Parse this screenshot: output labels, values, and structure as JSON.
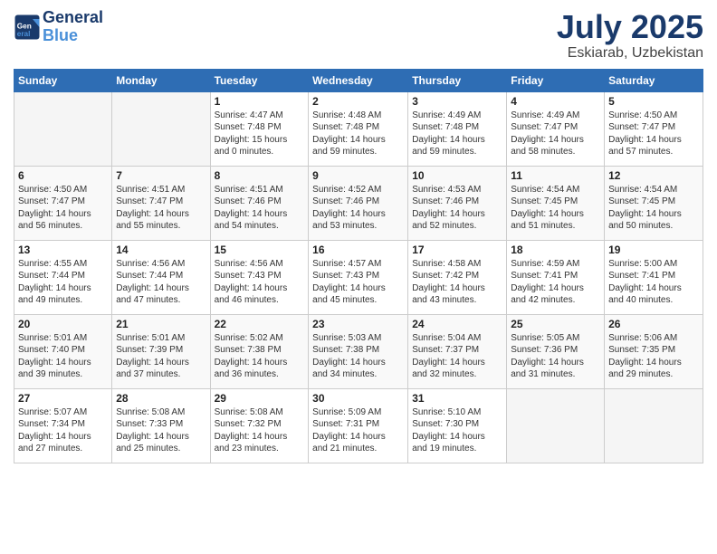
{
  "header": {
    "logo_line1": "General",
    "logo_line2": "Blue",
    "month": "July 2025",
    "location": "Eskiarab, Uzbekistan"
  },
  "days_of_week": [
    "Sunday",
    "Monday",
    "Tuesday",
    "Wednesday",
    "Thursday",
    "Friday",
    "Saturday"
  ],
  "weeks": [
    [
      {
        "day": "",
        "info": ""
      },
      {
        "day": "",
        "info": ""
      },
      {
        "day": "1",
        "info": "Sunrise: 4:47 AM\nSunset: 7:48 PM\nDaylight: 15 hours\nand 0 minutes."
      },
      {
        "day": "2",
        "info": "Sunrise: 4:48 AM\nSunset: 7:48 PM\nDaylight: 14 hours\nand 59 minutes."
      },
      {
        "day": "3",
        "info": "Sunrise: 4:49 AM\nSunset: 7:48 PM\nDaylight: 14 hours\nand 59 minutes."
      },
      {
        "day": "4",
        "info": "Sunrise: 4:49 AM\nSunset: 7:47 PM\nDaylight: 14 hours\nand 58 minutes."
      },
      {
        "day": "5",
        "info": "Sunrise: 4:50 AM\nSunset: 7:47 PM\nDaylight: 14 hours\nand 57 minutes."
      }
    ],
    [
      {
        "day": "6",
        "info": "Sunrise: 4:50 AM\nSunset: 7:47 PM\nDaylight: 14 hours\nand 56 minutes."
      },
      {
        "day": "7",
        "info": "Sunrise: 4:51 AM\nSunset: 7:47 PM\nDaylight: 14 hours\nand 55 minutes."
      },
      {
        "day": "8",
        "info": "Sunrise: 4:51 AM\nSunset: 7:46 PM\nDaylight: 14 hours\nand 54 minutes."
      },
      {
        "day": "9",
        "info": "Sunrise: 4:52 AM\nSunset: 7:46 PM\nDaylight: 14 hours\nand 53 minutes."
      },
      {
        "day": "10",
        "info": "Sunrise: 4:53 AM\nSunset: 7:46 PM\nDaylight: 14 hours\nand 52 minutes."
      },
      {
        "day": "11",
        "info": "Sunrise: 4:54 AM\nSunset: 7:45 PM\nDaylight: 14 hours\nand 51 minutes."
      },
      {
        "day": "12",
        "info": "Sunrise: 4:54 AM\nSunset: 7:45 PM\nDaylight: 14 hours\nand 50 minutes."
      }
    ],
    [
      {
        "day": "13",
        "info": "Sunrise: 4:55 AM\nSunset: 7:44 PM\nDaylight: 14 hours\nand 49 minutes."
      },
      {
        "day": "14",
        "info": "Sunrise: 4:56 AM\nSunset: 7:44 PM\nDaylight: 14 hours\nand 47 minutes."
      },
      {
        "day": "15",
        "info": "Sunrise: 4:56 AM\nSunset: 7:43 PM\nDaylight: 14 hours\nand 46 minutes."
      },
      {
        "day": "16",
        "info": "Sunrise: 4:57 AM\nSunset: 7:43 PM\nDaylight: 14 hours\nand 45 minutes."
      },
      {
        "day": "17",
        "info": "Sunrise: 4:58 AM\nSunset: 7:42 PM\nDaylight: 14 hours\nand 43 minutes."
      },
      {
        "day": "18",
        "info": "Sunrise: 4:59 AM\nSunset: 7:41 PM\nDaylight: 14 hours\nand 42 minutes."
      },
      {
        "day": "19",
        "info": "Sunrise: 5:00 AM\nSunset: 7:41 PM\nDaylight: 14 hours\nand 40 minutes."
      }
    ],
    [
      {
        "day": "20",
        "info": "Sunrise: 5:01 AM\nSunset: 7:40 PM\nDaylight: 14 hours\nand 39 minutes."
      },
      {
        "day": "21",
        "info": "Sunrise: 5:01 AM\nSunset: 7:39 PM\nDaylight: 14 hours\nand 37 minutes."
      },
      {
        "day": "22",
        "info": "Sunrise: 5:02 AM\nSunset: 7:38 PM\nDaylight: 14 hours\nand 36 minutes."
      },
      {
        "day": "23",
        "info": "Sunrise: 5:03 AM\nSunset: 7:38 PM\nDaylight: 14 hours\nand 34 minutes."
      },
      {
        "day": "24",
        "info": "Sunrise: 5:04 AM\nSunset: 7:37 PM\nDaylight: 14 hours\nand 32 minutes."
      },
      {
        "day": "25",
        "info": "Sunrise: 5:05 AM\nSunset: 7:36 PM\nDaylight: 14 hours\nand 31 minutes."
      },
      {
        "day": "26",
        "info": "Sunrise: 5:06 AM\nSunset: 7:35 PM\nDaylight: 14 hours\nand 29 minutes."
      }
    ],
    [
      {
        "day": "27",
        "info": "Sunrise: 5:07 AM\nSunset: 7:34 PM\nDaylight: 14 hours\nand 27 minutes."
      },
      {
        "day": "28",
        "info": "Sunrise: 5:08 AM\nSunset: 7:33 PM\nDaylight: 14 hours\nand 25 minutes."
      },
      {
        "day": "29",
        "info": "Sunrise: 5:08 AM\nSunset: 7:32 PM\nDaylight: 14 hours\nand 23 minutes."
      },
      {
        "day": "30",
        "info": "Sunrise: 5:09 AM\nSunset: 7:31 PM\nDaylight: 14 hours\nand 21 minutes."
      },
      {
        "day": "31",
        "info": "Sunrise: 5:10 AM\nSunset: 7:30 PM\nDaylight: 14 hours\nand 19 minutes."
      },
      {
        "day": "",
        "info": ""
      },
      {
        "day": "",
        "info": ""
      }
    ]
  ]
}
